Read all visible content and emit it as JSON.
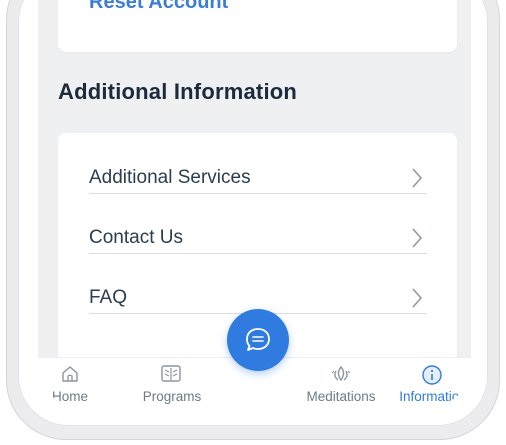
{
  "account": {
    "reset_label": "Reset Account"
  },
  "section": {
    "title": "Additional Information"
  },
  "list": {
    "items": [
      {
        "label": "Additional Services"
      },
      {
        "label": "Contact Us"
      },
      {
        "label": "FAQ"
      }
    ]
  },
  "tabbar": {
    "tabs": [
      {
        "label": "Home",
        "icon": "home-icon",
        "active": false
      },
      {
        "label": "Programs",
        "icon": "book-icon",
        "active": false
      },
      {
        "label": "Meditations",
        "icon": "lotus-icon",
        "active": false
      },
      {
        "label": "Information",
        "icon": "info-icon",
        "active": true
      }
    ],
    "center_button": {
      "icon": "chat-bubble-icon"
    }
  },
  "colors": {
    "accent": "#2f7be0",
    "text_dark": "#1d2a3b",
    "background": "#eff0f2"
  }
}
